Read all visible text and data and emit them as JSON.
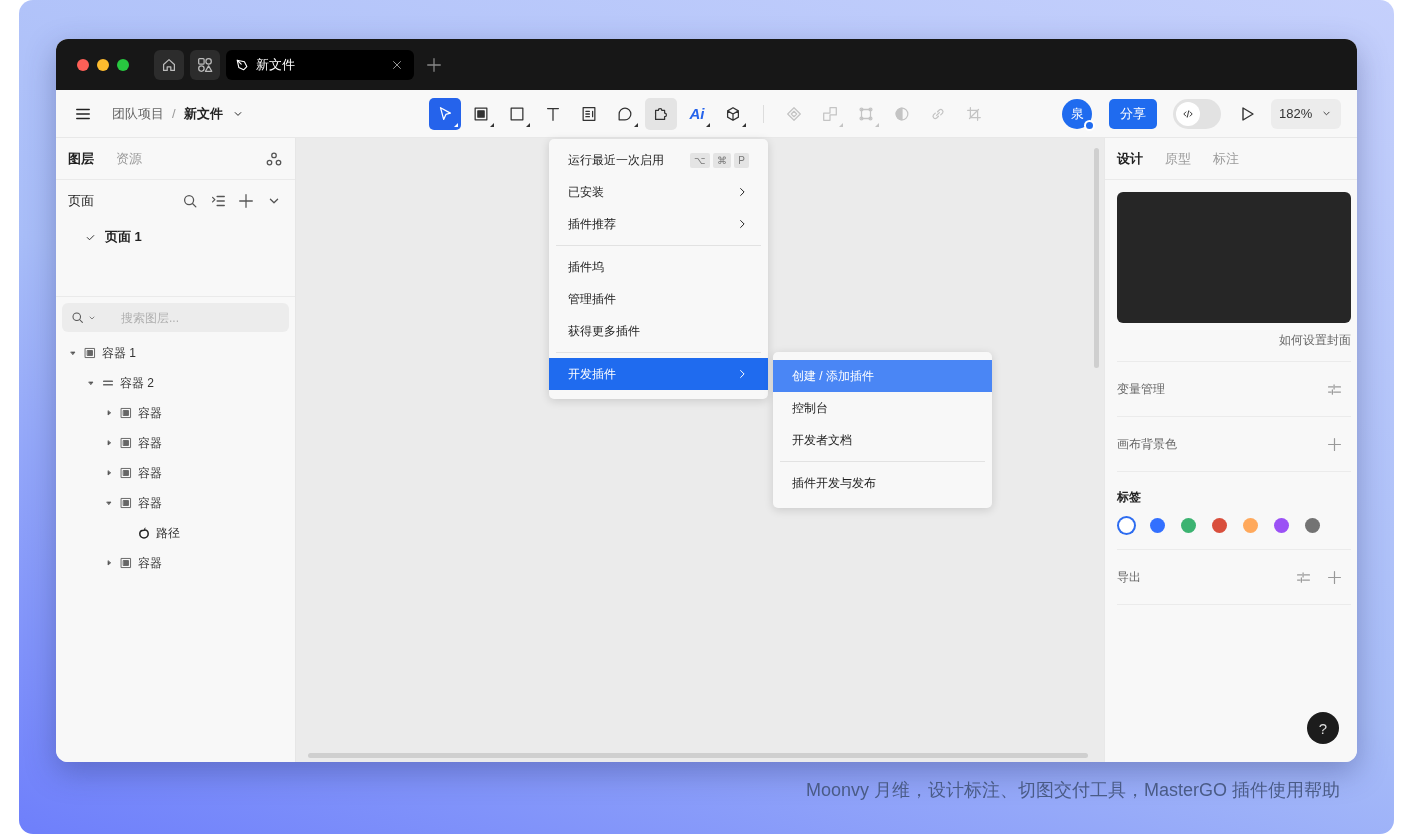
{
  "title_bar": {
    "tabs": [
      {
        "title": "新文件",
        "selected": true
      }
    ]
  },
  "toolbar": {
    "breadcrumb": [
      "团队项目",
      "新文件"
    ],
    "breadcrumb_separator": "/",
    "tool_groups": [
      [
        {
          "kind": "move",
          "selected": true,
          "expanded": false,
          "disabled": false,
          "dropdown": true
        },
        {
          "kind": "frame",
          "selected": false,
          "expanded": false,
          "disabled": false,
          "dropdown": true
        },
        {
          "kind": "rect",
          "selected": false,
          "expanded": false,
          "disabled": false,
          "dropdown": true
        },
        {
          "kind": "text",
          "selected": false,
          "expanded": false,
          "disabled": false,
          "dropdown": false
        },
        {
          "kind": "note",
          "selected": false,
          "expanded": false,
          "disabled": false,
          "dropdown": false
        },
        {
          "kind": "comment",
          "selected": false,
          "expanded": false,
          "disabled": false,
          "dropdown": true
        },
        {
          "kind": "plugin",
          "selected": false,
          "expanded": true,
          "disabled": false,
          "dropdown": false
        },
        {
          "kind": "ai",
          "label": "Ai",
          "selected": false,
          "expanded": false,
          "disabled": false,
          "dropdown": true
        },
        {
          "kind": "cube",
          "selected": false,
          "expanded": false,
          "disabled": false,
          "dropdown": true
        }
      ],
      [
        {
          "kind": "component",
          "selected": false,
          "expanded": false,
          "disabled": true,
          "dropdown": false
        },
        {
          "kind": "boolean",
          "selected": false,
          "expanded": false,
          "disabled": true,
          "dropdown": true
        },
        {
          "kind": "bounds",
          "selected": false,
          "expanded": false,
          "disabled": true,
          "dropdown": true
        },
        {
          "kind": "contrast",
          "selected": false,
          "expanded": false,
          "disabled": true,
          "dropdown": false
        },
        {
          "kind": "link",
          "selected": false,
          "expanded": false,
          "disabled": true,
          "dropdown": false
        },
        {
          "kind": "crop",
          "selected": false,
          "expanded": false,
          "disabled": true,
          "dropdown": false
        }
      ]
    ],
    "avatar": "泉",
    "share": "分享",
    "dev_mode": {
      "on": false
    },
    "zoom": "182%"
  },
  "left_panel": {
    "tabs": [
      {
        "label": "图层",
        "selected": true
      },
      {
        "label": "资源",
        "selected": false
      }
    ],
    "pages_title": "页面",
    "pages": [
      {
        "label": "页面 1",
        "selected": true
      }
    ],
    "search": {
      "placeholder": "搜索图层..."
    },
    "layers": [
      {
        "kind": "frame",
        "label": "容器 1",
        "expanded": true,
        "children": [
          {
            "kind": "autolayout",
            "label": "容器 2",
            "expanded": true,
            "children": [
              {
                "kind": "frame",
                "label": "容器",
                "expanded": false
              },
              {
                "kind": "frame",
                "label": "容器",
                "expanded": false
              },
              {
                "kind": "frame",
                "label": "容器",
                "expanded": false
              },
              {
                "kind": "frame",
                "label": "容器",
                "expanded": true,
                "children": [
                  {
                    "kind": "path",
                    "label": "路径"
                  }
                ]
              },
              {
                "kind": "frame",
                "label": "容器",
                "expanded": false
              }
            ]
          }
        ]
      }
    ]
  },
  "plugin_menu": {
    "items": [
      {
        "kind": "item",
        "label": "运行最近一次启用",
        "shortcut": [
          "⌥",
          "⌘",
          "P"
        ],
        "submenu": false,
        "selected": false
      },
      {
        "kind": "item",
        "label": "已安装",
        "submenu": true,
        "selected": false
      },
      {
        "kind": "item",
        "label": "插件推荐",
        "submenu": true,
        "selected": false
      },
      {
        "kind": "separator"
      },
      {
        "kind": "item",
        "label": "插件坞",
        "submenu": false,
        "selected": false
      },
      {
        "kind": "item",
        "label": "管理插件",
        "submenu": false,
        "selected": false
      },
      {
        "kind": "item",
        "label": "获得更多插件",
        "submenu": false,
        "selected": false
      },
      {
        "kind": "separator"
      },
      {
        "kind": "item",
        "label": "开发插件",
        "submenu": true,
        "selected": true
      }
    ],
    "submenu": {
      "items": [
        {
          "kind": "item",
          "label": "创建 / 添加插件",
          "selected": true
        },
        {
          "kind": "item",
          "label": "控制台",
          "selected": false
        },
        {
          "kind": "item",
          "label": "开发者文档",
          "selected": false
        },
        {
          "kind": "separator"
        },
        {
          "kind": "item",
          "label": "插件开发与发布",
          "selected": false
        }
      ]
    }
  },
  "right_panel": {
    "tabs": [
      {
        "label": "设计",
        "selected": true
      },
      {
        "label": "原型",
        "selected": false
      },
      {
        "label": "标注",
        "selected": false
      }
    ],
    "cover_link": "如何设置封面",
    "sections": [
      {
        "kind": "row",
        "label": "变量管理",
        "actions": [
          {
            "kind": "adjust"
          }
        ]
      },
      {
        "kind": "row",
        "label": "画布背景色",
        "actions": [
          {
            "kind": "add"
          }
        ]
      },
      {
        "kind": "tags",
        "label": "标签",
        "colors": [
          {
            "color": "#ffffff",
            "selected": true
          },
          {
            "color": "#3370ff",
            "selected": false
          },
          {
            "color": "#3cb371",
            "selected": false
          },
          {
            "color": "#d94f3d",
            "selected": false
          },
          {
            "color": "#ffa95c",
            "selected": false
          },
          {
            "color": "#9b51f5",
            "selected": false
          },
          {
            "color": "#737373",
            "selected": false
          }
        ]
      },
      {
        "kind": "row",
        "label": "导出",
        "actions": [
          {
            "kind": "adjust"
          },
          {
            "kind": "add"
          }
        ]
      }
    ]
  },
  "help": "?",
  "caption": "Moonvy 月维，设计标注、切图交付工具，MasterGO 插件使用帮助"
}
